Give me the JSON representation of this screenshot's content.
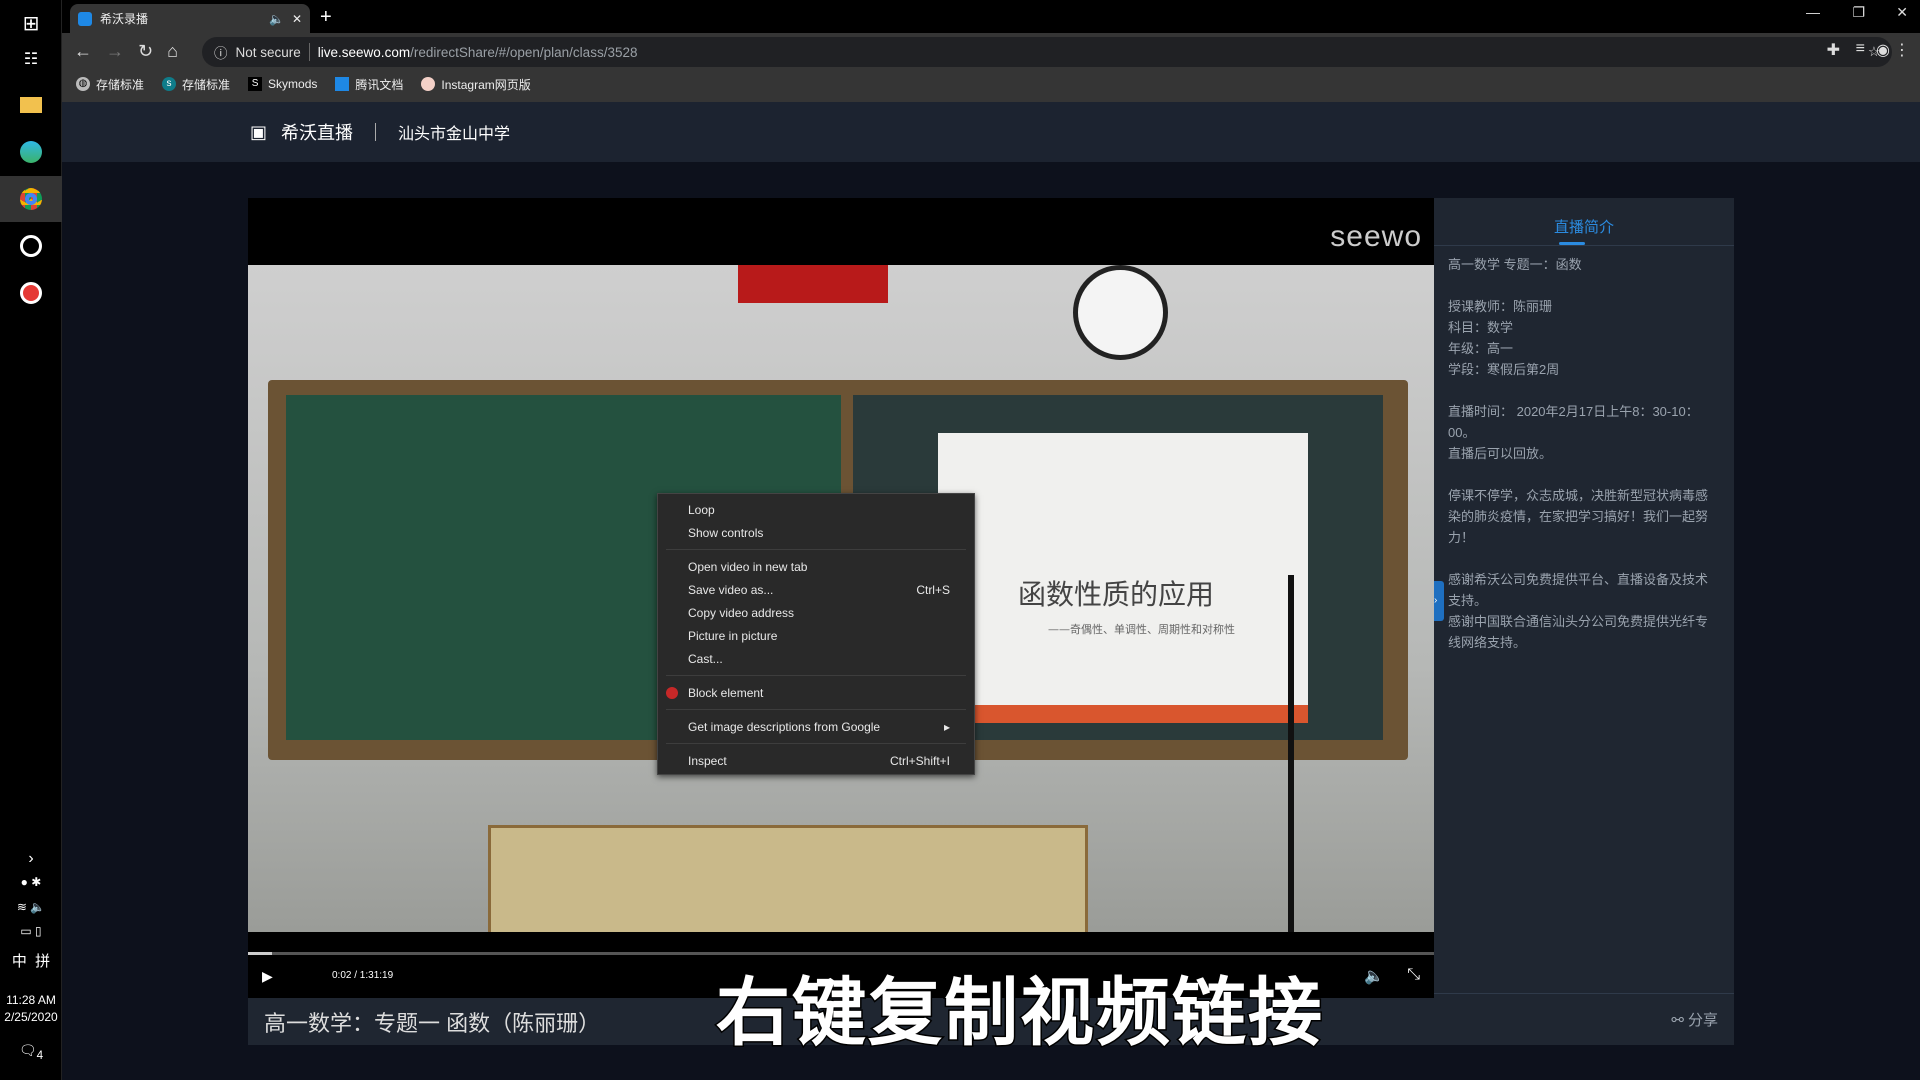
{
  "taskbar": {
    "clock_time": "11:28 AM",
    "clock_date": "2/25/2020",
    "ime": "中",
    "ime2": "拼",
    "notifications": "4"
  },
  "browser": {
    "tab_title": "希沃录播",
    "security": "Not secure",
    "url_host": "live.seewo.com",
    "url_path": "/redirectShare/#/open/plan/class/3528",
    "bookmarks": [
      "存储标准",
      "存储标准",
      "Skymods",
      "腾讯文档",
      "Instagram网页版"
    ]
  },
  "header": {
    "brand": "希沃直播",
    "school": "汕头市金山中学"
  },
  "player": {
    "watermark": "seewo",
    "slide_title": "函数性质的应用",
    "slide_subtitle": "——奇偶性、单调性、周期性和对称性",
    "time": "0:02 / 1:31:19",
    "progress_fraction": 0.0004,
    "title": "高一数学：专题一 函数（陈丽珊）",
    "caption": "右键复制视频链接"
  },
  "sidebar": {
    "tab": "直播简介",
    "lines": [
      "高一数学 专题一：函数",
      "",
      "授课教师：陈丽珊",
      "科目：数学",
      "年级：高一",
      "学段：寒假后第2周",
      "",
      "直播时间： 2020年2月17日上午8：30-10：00。",
      "直播后可以回放。",
      "",
      "停课不停学，众志成城，决胜新型冠状病毒感染的肺炎疫情，在家把学习搞好！我们一起努力！",
      "",
      "感谢希沃公司免费提供平台、直播设备及技术支持。",
      "感谢中国联合通信汕头分公司免费提供光纤专线网络支持。"
    ],
    "share": "分享"
  },
  "context_menu": {
    "items": [
      {
        "label": "Loop"
      },
      {
        "label": "Show controls"
      },
      {
        "label": "Open video in new tab"
      },
      {
        "label": "Save video as...",
        "shortcut": "Ctrl+S"
      },
      {
        "label": "Copy video address"
      },
      {
        "label": "Picture in picture"
      },
      {
        "label": "Cast..."
      },
      {
        "label": "Block element"
      },
      {
        "label": "Get image descriptions from Google"
      },
      {
        "label": "Inspect",
        "shortcut": "Ctrl+Shift+I"
      }
    ]
  },
  "colors": {
    "accent": "#2b8be0",
    "page_bg": "#0d111c",
    "panel_bg": "#1f2631"
  }
}
